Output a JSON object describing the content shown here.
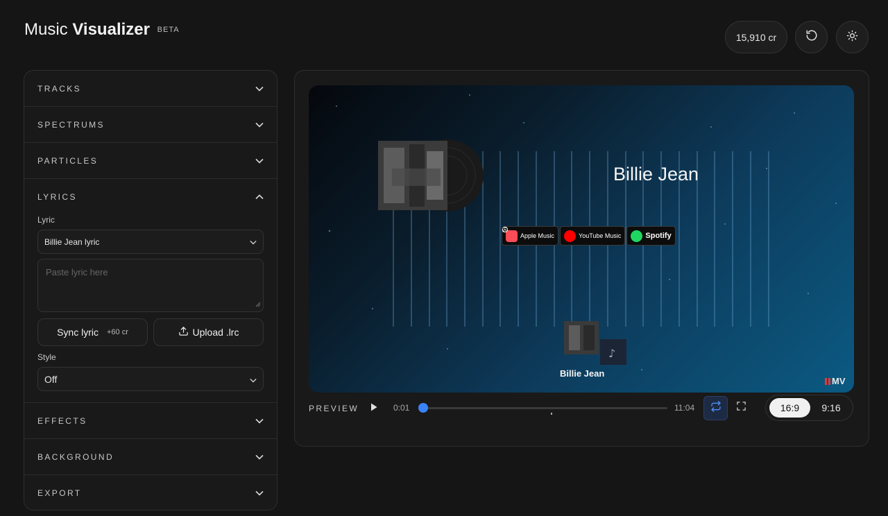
{
  "header": {
    "title_light": "Music",
    "title_bold": "Visualizer",
    "beta": "BETA",
    "credits": "15,910 cr",
    "reset_icon": "reset-icon",
    "theme_icon": "sun-icon"
  },
  "sidebar": {
    "sections": {
      "tracks": "TRACKS",
      "spectrums": "SPECTRUMS",
      "particles": "PARTICLES",
      "lyrics": "LYRICS",
      "effects": "EFFECTS",
      "background": "BACKGROUND",
      "export": "EXPORT"
    },
    "lyrics": {
      "lyric_label": "Lyric",
      "lyric_value": "Billie Jean lyric",
      "textarea_placeholder": "Paste lyric here",
      "sync_label": "Sync lyric",
      "sync_cost": "+60 cr",
      "upload_label": "Upload .lrc",
      "style_label": "Style",
      "style_value": "Off"
    }
  },
  "preview": {
    "song_title": "Billie Jean",
    "mini_title": "Billie Jean",
    "badges": {
      "apple": "Apple Music",
      "youtube": "YouTube Music",
      "spotify": "Spotify"
    },
    "logo": "MV",
    "controls": {
      "label": "PREVIEW",
      "current_time": "0:01",
      "duration": "11:04",
      "progress": 0.0015
    },
    "aspect": {
      "active": "16:9",
      "other": "9:16"
    },
    "colors": {
      "accent": "#3b82f6"
    }
  }
}
